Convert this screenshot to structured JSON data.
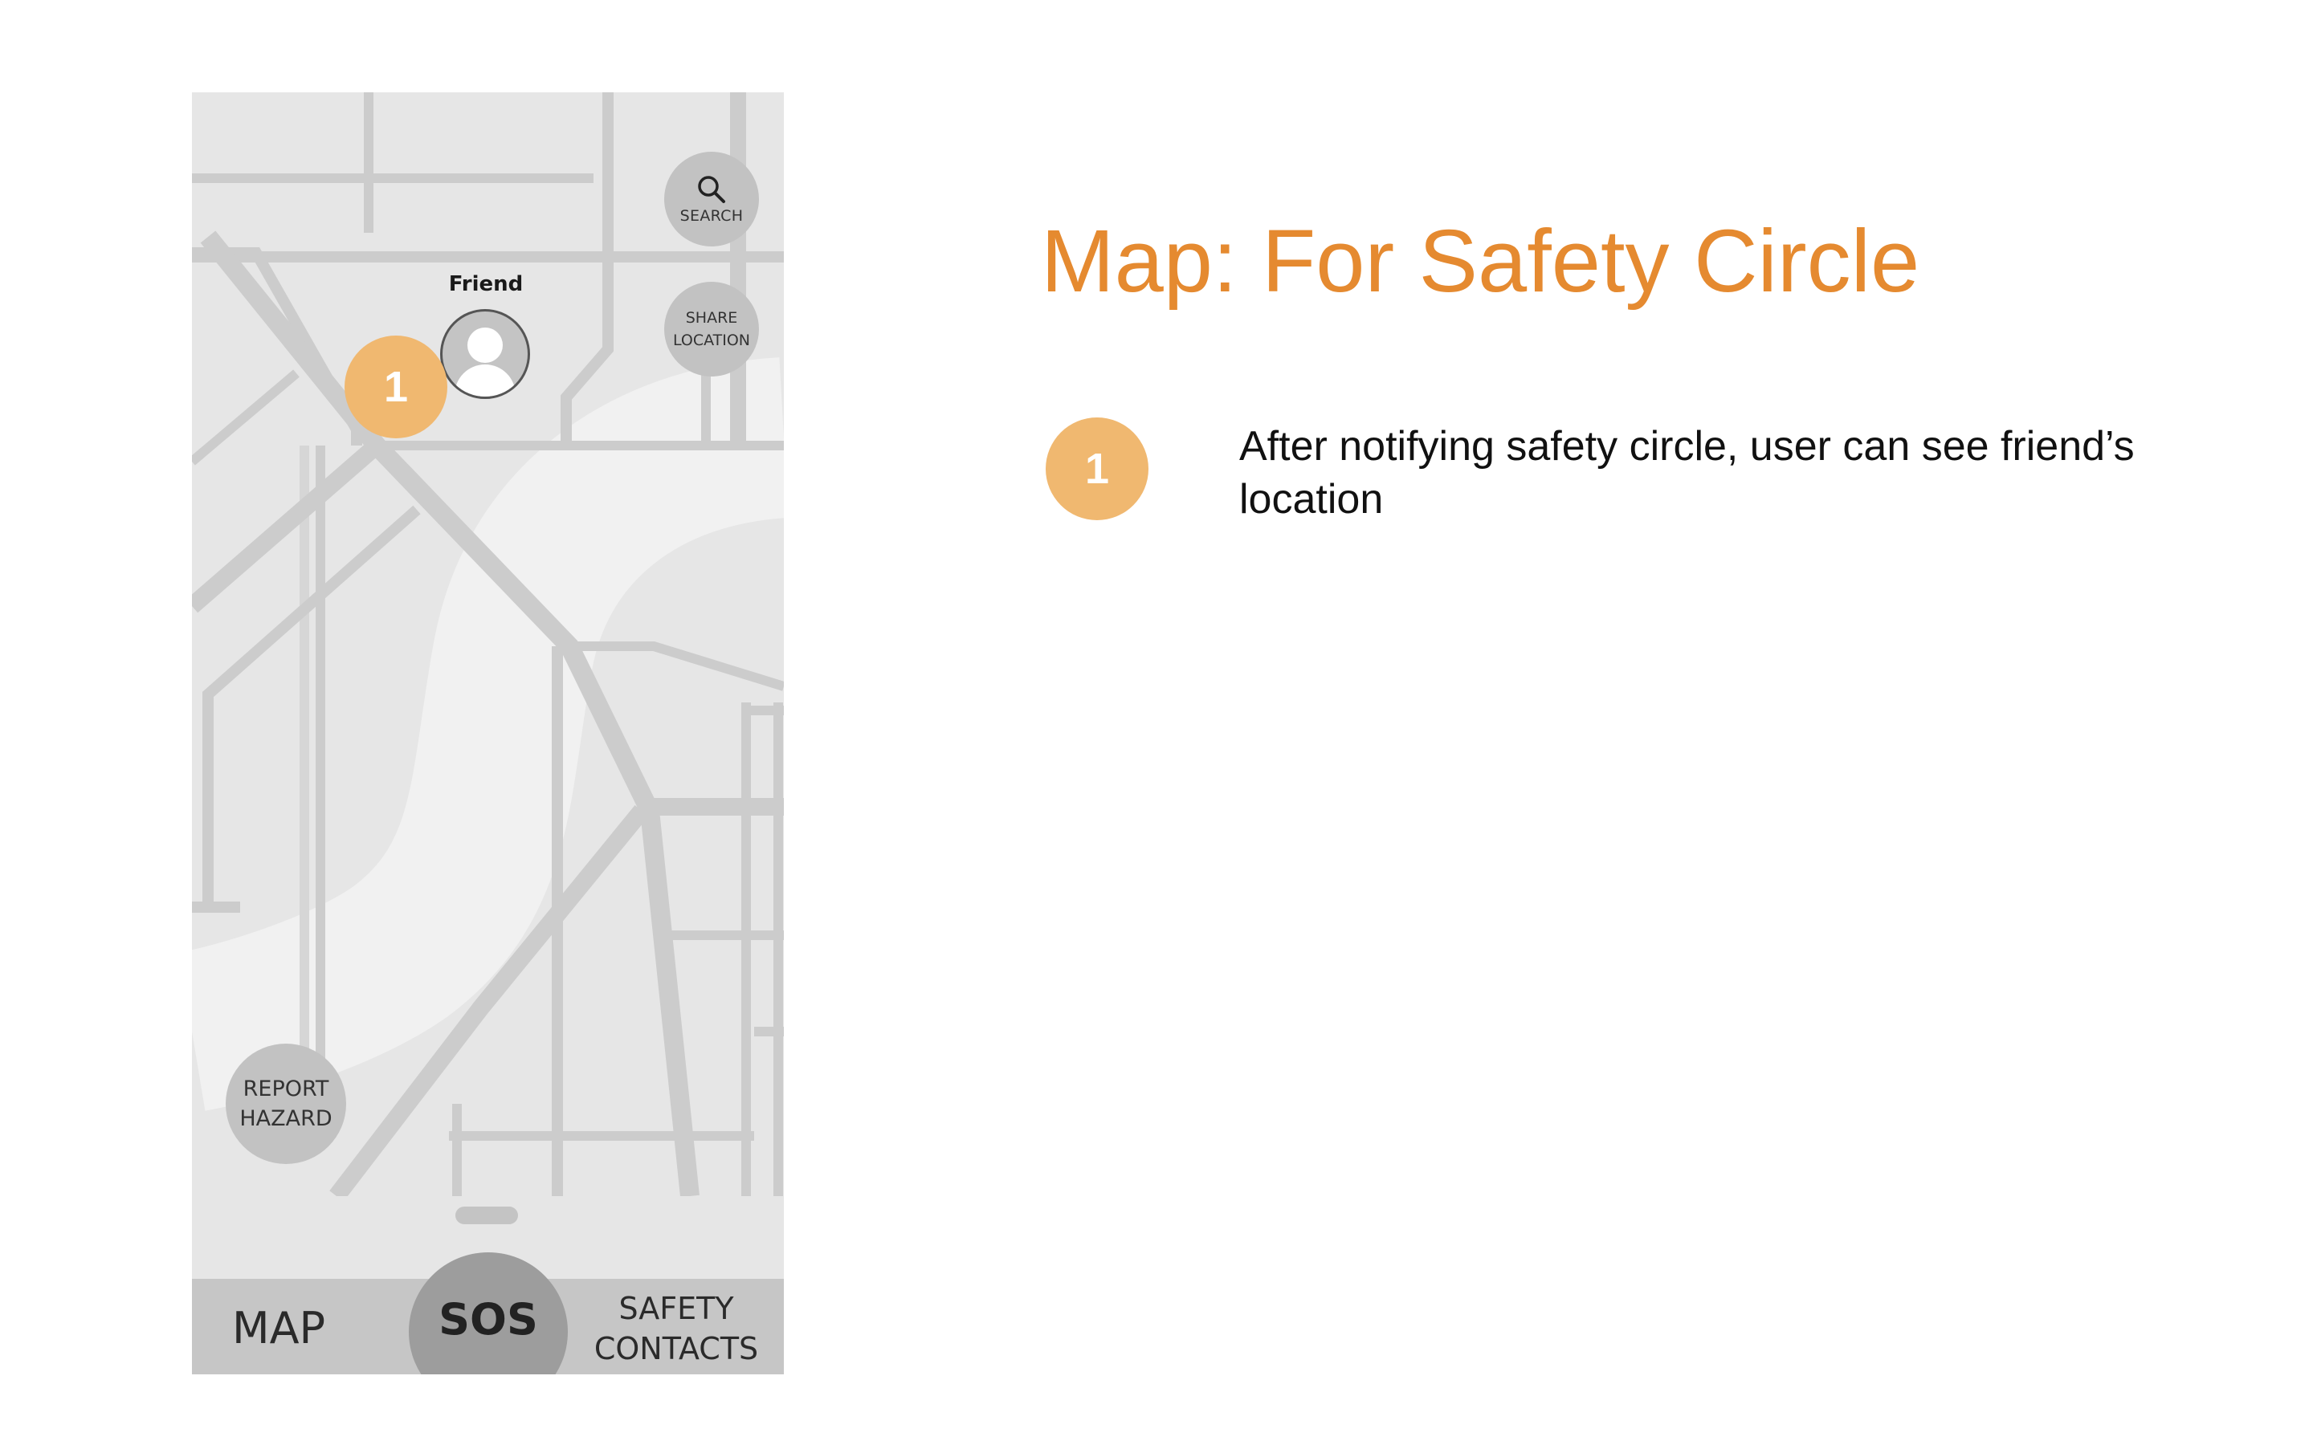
{
  "phone": {
    "search_label": "SEARCH",
    "share_label_line1": "SHARE",
    "share_label_line2": "LOCATION",
    "friend_label": "Friend",
    "marker_number": "1",
    "report_label_line1": "REPORT",
    "report_label_line2": "HAZARD",
    "nav": {
      "map_label": "MAP",
      "sos_label": "SOS",
      "safety_line1": "SAFETY",
      "safety_line2": "CONTACTS"
    }
  },
  "slide": {
    "title": "Map: For Safety Circle",
    "legend": [
      {
        "number": "1",
        "text": "After notifying safety circle, user can see friend’s location"
      }
    ]
  },
  "colors": {
    "accent_title": "#e58a30",
    "badge": "#f0b870",
    "map_background": "#e6e6e6",
    "map_roads": "#cccccc",
    "river": "#f1f1f1"
  },
  "icons": [
    "search-icon",
    "avatar-person-icon"
  ]
}
